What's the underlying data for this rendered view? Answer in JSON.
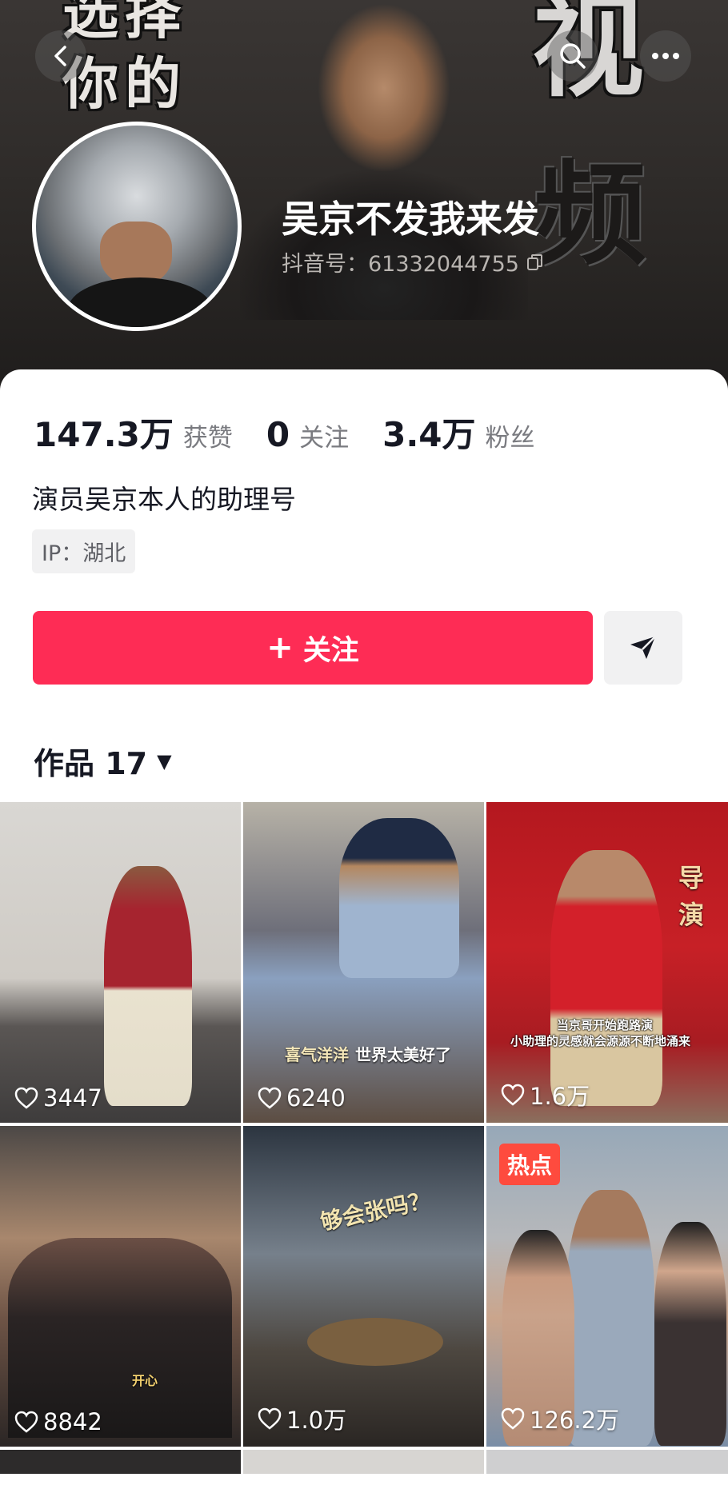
{
  "header": {
    "banner_text_1": "选择",
    "banner_text_2": "你的",
    "banner_text_3": "视",
    "banner_text_4": "频",
    "username": "吴京不发我来发",
    "douyin_id": "抖音号：61332044755"
  },
  "stats": [
    {
      "value": "147.3万",
      "label": "获赞"
    },
    {
      "value": "0",
      "label": "关注"
    },
    {
      "value": "3.4万",
      "label": "粉丝"
    }
  ],
  "bio": "演员吴京本人的助理号",
  "ip": "IP：湖北",
  "follow_label": "关注",
  "works_label": "作品 17",
  "videos": [
    {
      "likes": "3447"
    },
    {
      "likes": "6240",
      "caption_1": "喜气洋洋",
      "caption_2": "世界太美好了"
    },
    {
      "likes": "1.6万",
      "poster_text": "导演",
      "subtitle_1": "当京哥开始跑路演",
      "subtitle_2": "小助理的灵感就会源源不断地涌来"
    },
    {
      "likes": "8842",
      "caption": "开心"
    },
    {
      "likes": "1.0万",
      "caption": "够会张吗？"
    },
    {
      "likes": "126.2万",
      "badge": "热点"
    }
  ],
  "colors": {
    "accent": "#fe2c55",
    "hot_badge": "#fe4b3e"
  }
}
